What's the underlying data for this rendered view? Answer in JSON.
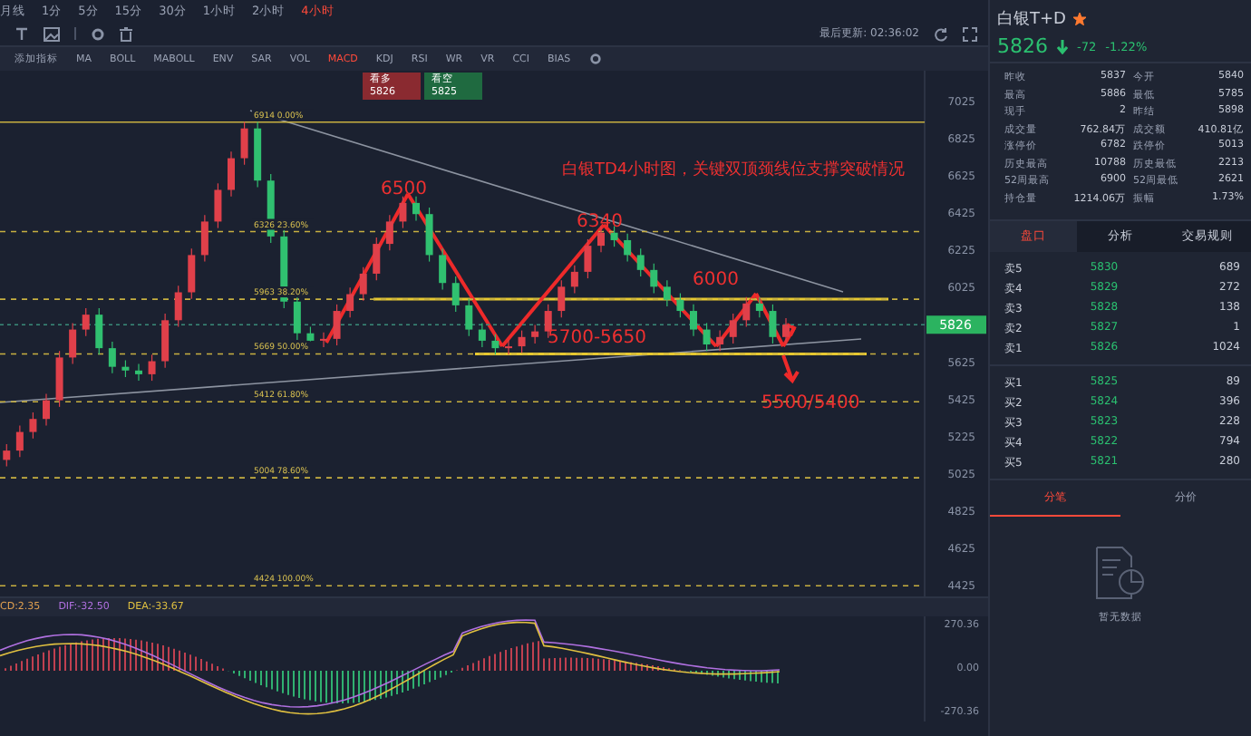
{
  "toolbar": {
    "timeframes": [
      {
        "label": "月线",
        "selected": false
      },
      {
        "label": "1分",
        "selected": false
      },
      {
        "label": "5分",
        "selected": false
      },
      {
        "label": "15分",
        "selected": false
      },
      {
        "label": "30分",
        "selected": false
      },
      {
        "label": "1小时",
        "selected": false
      },
      {
        "label": "2小时",
        "selected": false
      },
      {
        "label": "4小时",
        "selected": true
      }
    ],
    "indicators": [
      {
        "label": "添加指标",
        "selected": false
      },
      {
        "label": "MA",
        "selected": false
      },
      {
        "label": "BOLL",
        "selected": false
      },
      {
        "label": "MABOLL",
        "selected": false
      },
      {
        "label": "ENV",
        "selected": false
      },
      {
        "label": "SAR",
        "selected": false
      },
      {
        "label": "VOL",
        "selected": false
      },
      {
        "label": "MACD",
        "selected": true
      },
      {
        "label": "KDJ",
        "selected": false
      },
      {
        "label": "RSI",
        "selected": false
      },
      {
        "label": "WR",
        "selected": false
      },
      {
        "label": "VR",
        "selected": false
      },
      {
        "label": "CCI",
        "selected": false
      },
      {
        "label": "BIAS",
        "selected": false
      }
    ],
    "last_update": "最后更新: 02:36:02"
  },
  "trade_buttons": [
    {
      "kind": "long",
      "label": "看多",
      "price": "5826"
    },
    {
      "kind": "short",
      "label": "看空",
      "price": "5825"
    }
  ],
  "chart": {
    "note": "白银TD4小时图，关键双顶颈线位支撑突破情况",
    "annotations": [
      "6500",
      "6340",
      "6000",
      "5700-5650",
      "5500/5400"
    ],
    "price_axis": [
      "7025",
      "6825",
      "6625",
      "6425",
      "6225",
      "6025",
      "5625",
      "5425",
      "5225",
      "5025",
      "4825",
      "4625",
      "4425"
    ],
    "fib_levels": [
      "6914 0.00%",
      "6326 23.60%",
      "5963 38.20%",
      "5669 50.00%",
      "5412 61.80%",
      "5004 78.60%",
      "4424 100.00%"
    ],
    "current_price": "5826",
    "chart_data": {
      "type": "candlestick",
      "categories": [
        null,
        null,
        null,
        null,
        null,
        null,
        null,
        null,
        null,
        null,
        null,
        null,
        null,
        null,
        null,
        null,
        null,
        null,
        null,
        null,
        null,
        null,
        null,
        null,
        null,
        null,
        null,
        null,
        null,
        null,
        null,
        null,
        null,
        null,
        null,
        null,
        null,
        null,
        null,
        null,
        null,
        null,
        null,
        null,
        null,
        null,
        null,
        null,
        null,
        null,
        null,
        null,
        null,
        null,
        null,
        null,
        null,
        null,
        null,
        null,
        null,
        null,
        null,
        null,
        null,
        null,
        null,
        null,
        null,
        null
      ],
      "ylim": [
        4367,
        7190
      ],
      "ref_lines": [
        {
          "axis": "y",
          "value": 6914
        },
        {
          "axis": "y",
          "value": 6326
        },
        {
          "axis": "y",
          "value": 5963
        },
        {
          "axis": "y",
          "value": 5669
        },
        {
          "axis": "y",
          "value": 5412
        },
        {
          "axis": "y",
          "value": 5004
        },
        {
          "axis": "y",
          "value": 4424
        },
        {
          "axis": "y",
          "value": 5826
        }
      ],
      "yticks": [
        7025,
        6825,
        6625,
        6425,
        6225,
        6025,
        5625,
        5425,
        5225,
        5025,
        4825,
        4625,
        4425
      ],
      "ohlc": [
        [
          5100,
          5185,
          5065,
          5150
        ],
        [
          5150,
          5285,
          5115,
          5250
        ],
        [
          5250,
          5355,
          5215,
          5320
        ],
        [
          5320,
          5455,
          5285,
          5420
        ],
        [
          5420,
          5685,
          5385,
          5650
        ],
        [
          5650,
          5835,
          5615,
          5800
        ],
        [
          5800,
          5915,
          5765,
          5880
        ],
        [
          5880,
          5915,
          5665,
          5700
        ],
        [
          5700,
          5735,
          5565,
          5600
        ],
        [
          5600,
          5635,
          5545,
          5580
        ],
        [
          5580,
          5615,
          5525,
          5560
        ],
        [
          5560,
          5665,
          5525,
          5630
        ],
        [
          5630,
          5885,
          5595,
          5850
        ],
        [
          5850,
          6035,
          5815,
          6000
        ],
        [
          6000,
          6235,
          5965,
          6200
        ],
        [
          6200,
          6415,
          6165,
          6380
        ],
        [
          6380,
          6585,
          6345,
          6550
        ],
        [
          6550,
          6755,
          6515,
          6720
        ],
        [
          6720,
          6915,
          6685,
          6880
        ],
        [
          6880,
          6915,
          6565,
          6600
        ],
        [
          6600,
          6635,
          6265,
          6300
        ],
        [
          6300,
          6335,
          5915,
          5950
        ],
        [
          5950,
          5985,
          5745,
          5780
        ],
        [
          5780,
          5815,
          5705,
          5740
        ],
        [
          5740,
          5785,
          5705,
          5750
        ],
        [
          5750,
          5935,
          5715,
          5900
        ],
        [
          5900,
          6025,
          5865,
          5990
        ],
        [
          5990,
          6135,
          5955,
          6100
        ],
        [
          6100,
          6295,
          6065,
          6260
        ],
        [
          6260,
          6415,
          6225,
          6380
        ],
        [
          6380,
          6515,
          6345,
          6480
        ],
        [
          6480,
          6515,
          6385,
          6420
        ],
        [
          6420,
          6455,
          6165,
          6200
        ],
        [
          6200,
          6235,
          6015,
          6050
        ],
        [
          6050,
          6085,
          5895,
          5930
        ],
        [
          5930,
          5965,
          5765,
          5800
        ],
        [
          5800,
          5835,
          5705,
          5740
        ],
        [
          5740,
          5775,
          5665,
          5700
        ],
        [
          5700,
          5745,
          5665,
          5710
        ],
        [
          5710,
          5795,
          5675,
          5760
        ],
        [
          5760,
          5825,
          5725,
          5790
        ],
        [
          5790,
          5935,
          5755,
          5900
        ],
        [
          5900,
          6065,
          5865,
          6030
        ],
        [
          6030,
          6145,
          5995,
          6110
        ],
        [
          6110,
          6285,
          6075,
          6250
        ],
        [
          6250,
          6355,
          6215,
          6320
        ],
        [
          6320,
          6355,
          6245,
          6280
        ],
        [
          6280,
          6315,
          6165,
          6200
        ],
        [
          6200,
          6235,
          6085,
          6120
        ],
        [
          6120,
          6155,
          5995,
          6030
        ],
        [
          6030,
          6065,
          5925,
          5960
        ],
        [
          5960,
          5995,
          5865,
          5900
        ],
        [
          5900,
          5935,
          5765,
          5800
        ],
        [
          5800,
          5835,
          5685,
          5720
        ],
        [
          5720,
          5795,
          5685,
          5760
        ],
        [
          5760,
          5885,
          5725,
          5850
        ],
        [
          5850,
          5975,
          5815,
          5940
        ],
        [
          5940,
          5975,
          5865,
          5900
        ],
        [
          5900,
          5935,
          5725,
          5760
        ],
        [
          5760,
          5861,
          5725,
          5826
        ],
        null,
        null,
        null,
        null,
        null,
        null,
        null,
        null,
        null,
        null
      ]
    }
  },
  "macd": {
    "labels": [
      {
        "text": "CD:2.35",
        "color": "#e0a050"
      },
      {
        "text": "DIF:-32.50",
        "color": "#b070e0"
      },
      {
        "text": "DEA:-33.67",
        "color": "#e0c040"
      }
    ],
    "axis": [
      "270.36",
      "0.00",
      "-270.36"
    ]
  },
  "quote": {
    "name": "白银T+D",
    "favorite": true,
    "price": "5826",
    "change": "-72",
    "change_pct": "-1.22%",
    "stats": [
      {
        "label": "昨收",
        "value": "5837"
      },
      {
        "label": "今开",
        "value": "5840"
      },
      {
        "label": "最高",
        "value": "5886"
      },
      {
        "label": "最低",
        "value": "5785"
      },
      {
        "label": "现手",
        "value": "2"
      },
      {
        "label": "昨结",
        "value": "5898"
      },
      {
        "label": "成交量",
        "value": "762.84万"
      },
      {
        "label": "成交额",
        "value": "410.81亿"
      },
      {
        "label": "涨停价",
        "value": "6782"
      },
      {
        "label": "跌停价",
        "value": "5013"
      },
      {
        "label": "历史最高",
        "value": "10788"
      },
      {
        "label": "历史最低",
        "value": "2213"
      },
      {
        "label": "52周最高",
        "value": "6900"
      },
      {
        "label": "52周最低",
        "value": "2621"
      },
      {
        "label": "持仓量",
        "value": "1214.06万"
      },
      {
        "label": "振幅",
        "value": "1.73%"
      }
    ]
  },
  "tabs": [
    {
      "label": "盘口",
      "selected": true
    },
    {
      "label": "分析",
      "selected": false
    },
    {
      "label": "交易规则",
      "selected": false
    }
  ],
  "order_book": {
    "asks": [
      {
        "label": "卖5",
        "price": "5830",
        "volume": "689"
      },
      {
        "label": "卖4",
        "price": "5829",
        "volume": "272"
      },
      {
        "label": "卖3",
        "price": "5828",
        "volume": "138"
      },
      {
        "label": "卖2",
        "price": "5827",
        "volume": "1"
      },
      {
        "label": "卖1",
        "price": "5826",
        "volume": "1024"
      }
    ],
    "bids": [
      {
        "label": "买1",
        "price": "5825",
        "volume": "89"
      },
      {
        "label": "买2",
        "price": "5824",
        "volume": "396"
      },
      {
        "label": "买3",
        "price": "5823",
        "volume": "228"
      },
      {
        "label": "买4",
        "price": "5822",
        "volume": "794"
      },
      {
        "label": "买5",
        "price": "5821",
        "volume": "280"
      }
    ]
  },
  "trade_tabs": [
    {
      "label": "分笔",
      "selected": true
    },
    {
      "label": "分价",
      "selected": false
    }
  ],
  "empty_text": "暂无数据"
}
